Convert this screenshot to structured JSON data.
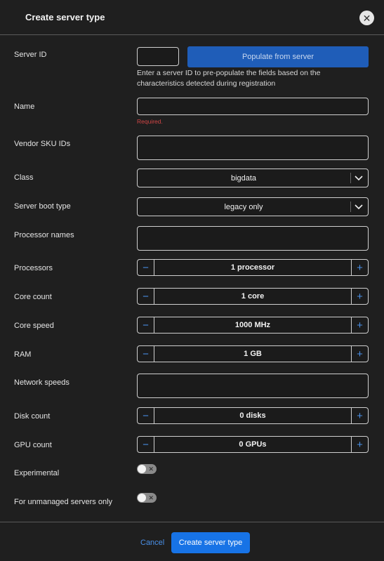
{
  "dialog": {
    "title": "Create server type",
    "close_icon": "close-icon"
  },
  "server_id": {
    "label": "Server ID",
    "value": "",
    "populate_label": "Populate from server",
    "help": "Enter a server ID to pre-populate the fields based on the characteristics detected during registration"
  },
  "name": {
    "label": "Name",
    "value": "",
    "error": "Required."
  },
  "vendor_sku": {
    "label": "Vendor SKU IDs",
    "value": ""
  },
  "class": {
    "label": "Class",
    "value": "bigdata"
  },
  "boot_type": {
    "label": "Server boot type",
    "value": "legacy only"
  },
  "processor_names": {
    "label": "Processor names",
    "value": ""
  },
  "processors": {
    "label": "Processors",
    "value": "1 processor"
  },
  "core_count": {
    "label": "Core count",
    "value": "1 core"
  },
  "core_speed": {
    "label": "Core speed",
    "value": "1000 MHz"
  },
  "ram": {
    "label": "RAM",
    "value": "1 GB"
  },
  "network_speeds": {
    "label": "Network speeds",
    "value": ""
  },
  "disk_count": {
    "label": "Disk count",
    "value": "0 disks"
  },
  "gpu_count": {
    "label": "GPU count",
    "value": "0 GPUs"
  },
  "experimental": {
    "label": "Experimental",
    "on": false
  },
  "unmanaged_only": {
    "label": "For unmanaged servers only",
    "on": false
  },
  "stepper": {
    "minus": "−",
    "plus": "+"
  },
  "toggle_off_glyph": "✕",
  "footer": {
    "cancel_label": "Cancel",
    "create_label": "Create server type"
  },
  "colors": {
    "primary": "#1773e6",
    "populate": "#1f5db8",
    "link": "#4a90e8",
    "error": "#d04545"
  }
}
